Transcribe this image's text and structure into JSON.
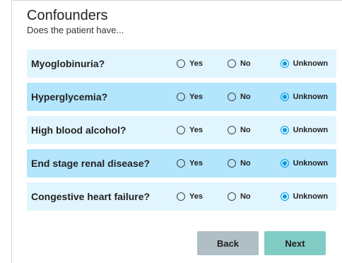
{
  "header": {
    "title": "Confounders",
    "subtitle": "Does the patient have..."
  },
  "options": {
    "yes": "Yes",
    "no": "No",
    "unknown": "Unknown"
  },
  "questions": [
    {
      "label": "Myoglobinuria?",
      "selected": "unknown"
    },
    {
      "label": "Hyperglycemia?",
      "selected": "unknown"
    },
    {
      "label": "High blood alcohol?",
      "selected": "unknown"
    },
    {
      "label": "End stage renal disease?",
      "selected": "unknown"
    },
    {
      "label": "Congestive heart failure?",
      "selected": "unknown"
    }
  ],
  "buttons": {
    "back": "Back",
    "next": "Next"
  },
  "colors": {
    "row_light": "#e1f5fe",
    "row_dark": "#b3e5fc",
    "radio_selected": "#039be5",
    "back_button": "#b0bec5",
    "next_button": "#80cbc4"
  }
}
